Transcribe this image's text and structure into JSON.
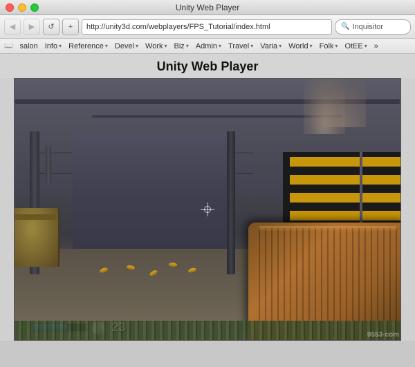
{
  "window": {
    "title": "Unity Web Player"
  },
  "toolbar": {
    "back_label": "◀",
    "forward_label": "▶",
    "reload_label": "↺",
    "new_tab_label": "+",
    "address": "http://unity3d.com/webplayers/FPS_Tutorial/index.html",
    "search_placeholder": "Inquisitor"
  },
  "bookmarks": [
    {
      "label": "salon"
    },
    {
      "label": "Info",
      "has_chevron": true
    },
    {
      "label": "Reference",
      "has_chevron": true
    },
    {
      "label": "Devel",
      "has_chevron": true
    },
    {
      "label": "Work",
      "has_chevron": true
    },
    {
      "label": "Biz",
      "has_chevron": true
    },
    {
      "label": "Admin",
      "has_chevron": true
    },
    {
      "label": "Travel",
      "has_chevron": true
    },
    {
      "label": "Varia",
      "has_chevron": true
    },
    {
      "label": "World",
      "has_chevron": true
    },
    {
      "label": "Folk",
      "has_chevron": true
    },
    {
      "label": "OtEE",
      "has_chevron": true
    },
    {
      "label": "»"
    }
  ],
  "page": {
    "title": "Unity Web Player"
  },
  "hud": {
    "health_percent": 65,
    "ammo_count": "23"
  },
  "watermark": "9553·com"
}
